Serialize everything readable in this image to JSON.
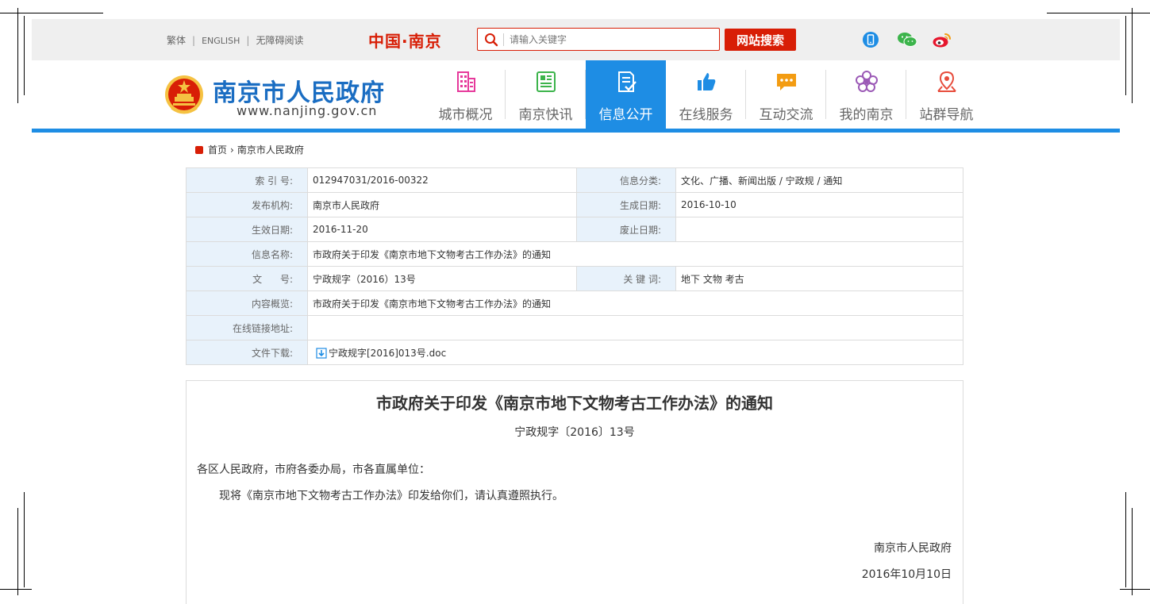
{
  "toplinks": {
    "traditional": "繁体",
    "english": "ENGLISH",
    "accessible": "无障碍阅读"
  },
  "logo_small": "中国·南京",
  "search": {
    "placeholder": "请输入关键字",
    "button": "网站搜索",
    "icon": "search-icon"
  },
  "social": [
    "mobile-icon",
    "wechat-icon",
    "weibo-icon"
  ],
  "site": {
    "title": "南京市人民政府",
    "url": "www.nanjing.gov.cn"
  },
  "nav": [
    {
      "label": "城市概况",
      "icon": "building-icon",
      "color": "#e6399b"
    },
    {
      "label": "南京快讯",
      "icon": "news-icon",
      "color": "#3cb44b"
    },
    {
      "label": "信息公开",
      "icon": "document-check-icon",
      "color": "#ffffff",
      "active": true
    },
    {
      "label": "在线服务",
      "icon": "thumbs-up-icon",
      "color": "#1e8de4"
    },
    {
      "label": "互动交流",
      "icon": "chat-icon",
      "color": "#f39c12"
    },
    {
      "label": "我的南京",
      "icon": "plum-flower-icon",
      "color": "#9b59b6"
    },
    {
      "label": "站群导航",
      "icon": "map-pin-icon",
      "color": "#e74c3c"
    }
  ],
  "breadcrumb": {
    "home": "首页",
    "current": "南京市人民政府"
  },
  "meta": {
    "index_label": "索 引 号:",
    "index_value": "012947031/2016-00322",
    "category_label": "信息分类:",
    "category_value": "文化、广播、新闻出版 / 宁政规 / 通知",
    "issuer_label": "发布机构:",
    "issuer_value": "南京市人民政府",
    "created_label": "生成日期:",
    "created_value": "2016-10-10",
    "effective_label": "生效日期:",
    "effective_value": "2016-11-20",
    "abolished_label": "废止日期:",
    "abolished_value": "",
    "name_label": "信息名称:",
    "name_value": "市政府关于印发《南京市地下文物考古工作办法》的通知",
    "docno_label": "文      号:",
    "docno_value": "宁政规字（2016）13号",
    "keywords_label": "关 键 词:",
    "keywords_value": "地下 文物 考古",
    "summary_label": "内容概览:",
    "summary_value": "市政府关于印发《南京市地下文物考古工作办法》的通知",
    "link_label": "在线链接地址:",
    "link_value": "",
    "download_label": "文件下载:",
    "download_value": "宁政规字[2016]013号.doc"
  },
  "doc": {
    "title": "市政府关于印发《南京市地下文物考古工作办法》的通知",
    "number": "宁政规字〔2016〕13号",
    "salutation": "各区人民政府，市府各委办局，市各直属单位：",
    "body": "现将《南京市地下文物考古工作办法》印发给你们，请认真遵照执行。",
    "signature": "南京市人民政府",
    "date": "2016年10月10日"
  }
}
